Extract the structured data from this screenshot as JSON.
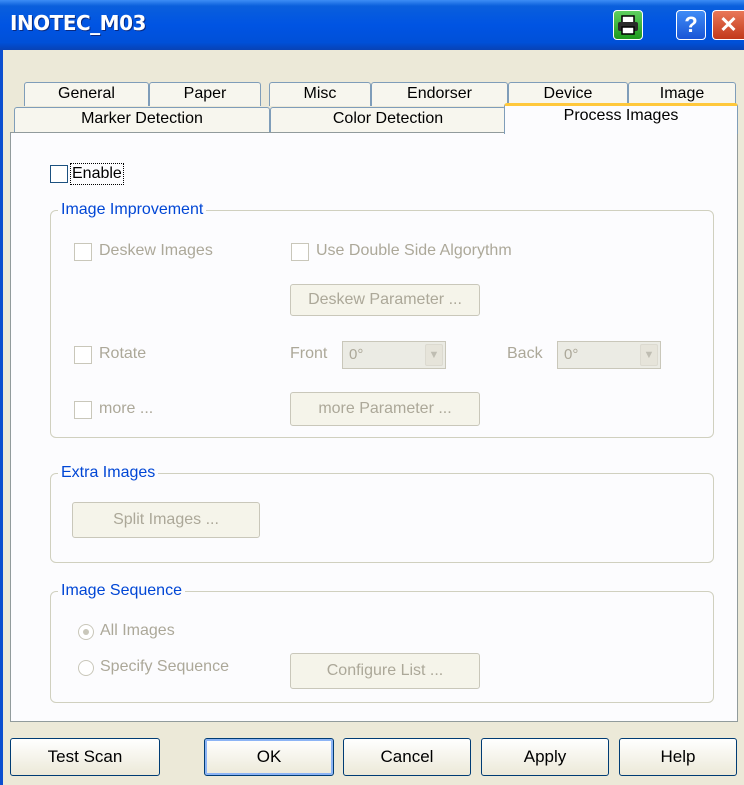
{
  "window": {
    "title": "INOTEC_M03"
  },
  "tabs_row1": [
    "General",
    "Paper",
    "Misc",
    "Endorser",
    "Device",
    "Image"
  ],
  "tabs_row2": [
    "Marker Detection",
    "Color Detection",
    "Process Images"
  ],
  "enable_label": "Enable",
  "image_improvement": {
    "legend": "Image Improvement",
    "deskew_label": "Deskew Images",
    "double_side_label": "Use Double Side Algorythm",
    "deskew_param_button": "Deskew Parameter ...",
    "rotate_label": "Rotate",
    "front_label": "Front",
    "front_value": "0°",
    "back_label": "Back",
    "back_value": "0°",
    "more_label": "more ...",
    "more_param_button": "more Parameter ..."
  },
  "extra_images": {
    "legend": "Extra Images",
    "split_button": "Split Images ..."
  },
  "image_sequence": {
    "legend": "Image Sequence",
    "all_images_label": "All Images",
    "specify_label": "Specify Sequence",
    "configure_button": "Configure List ..."
  },
  "buttons": {
    "test_scan": "Test Scan",
    "ok": "OK",
    "cancel": "Cancel",
    "apply": "Apply",
    "help": "Help"
  },
  "icons": {
    "printer": "printer-icon",
    "help": "help-icon",
    "close": "close-icon"
  },
  "colors": {
    "titlebar": "#0054e3",
    "legend": "#0046d5",
    "active_tab_accent": "#ffc83c",
    "disabled_text": "#aca899"
  }
}
